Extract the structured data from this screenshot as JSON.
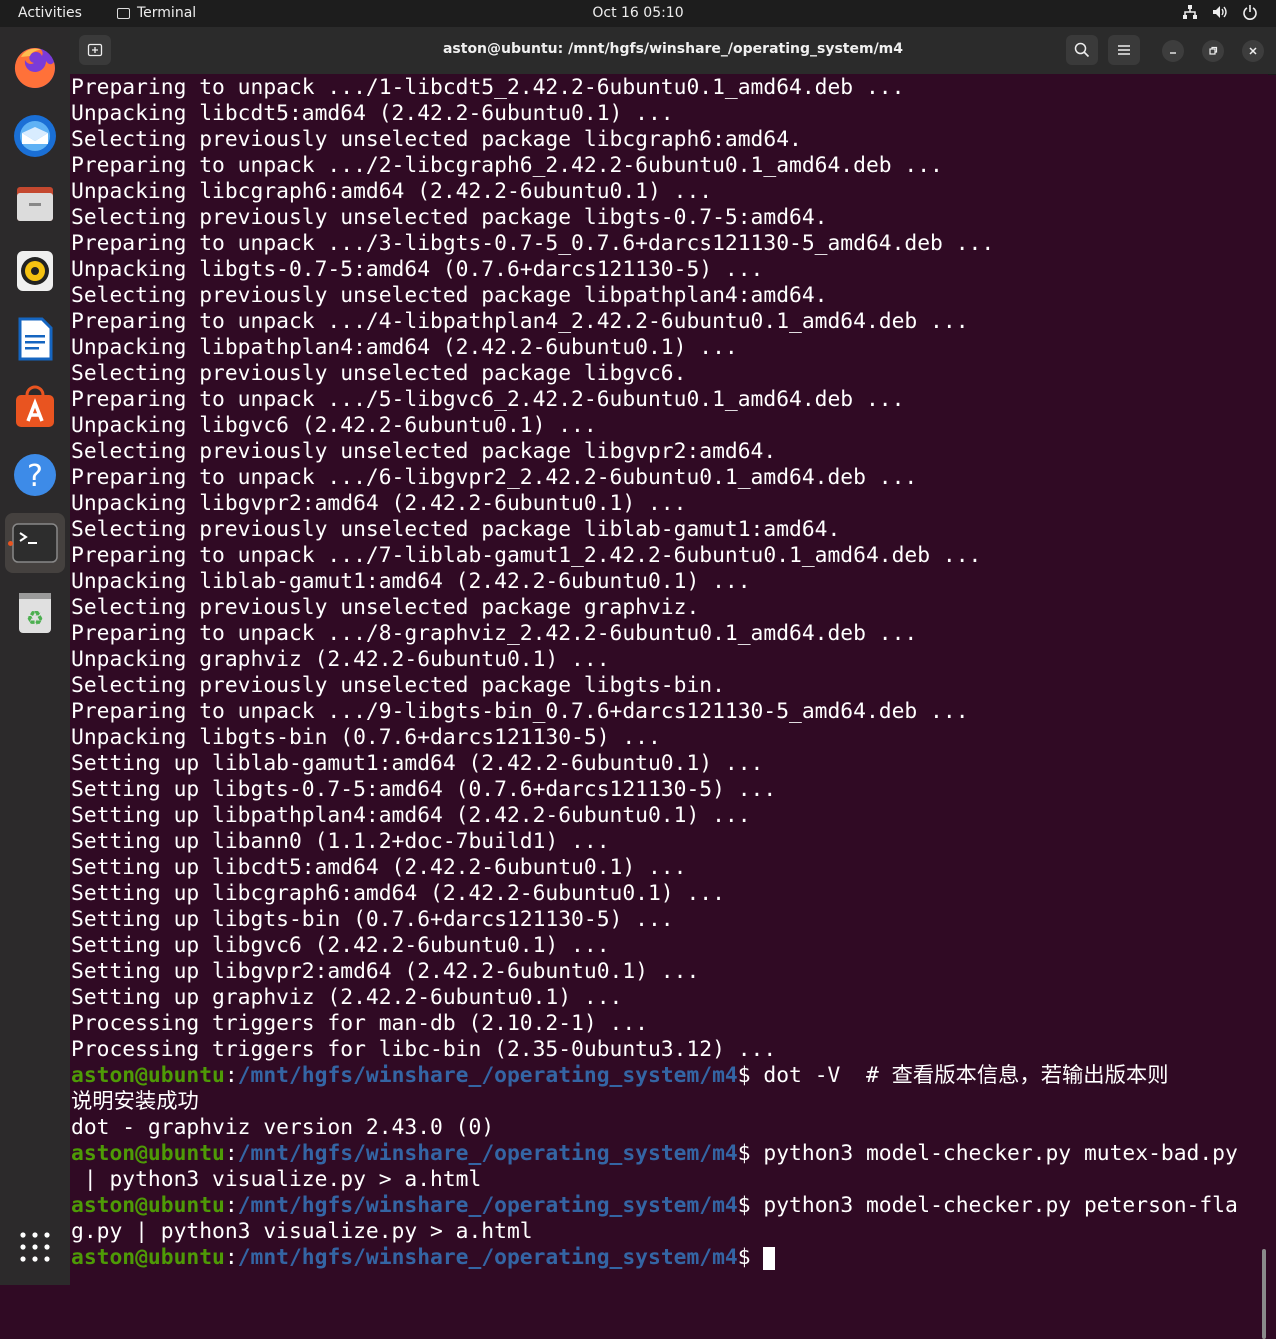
{
  "topbar": {
    "activities": "Activities",
    "app_name": "Terminal",
    "clock": "Oct 16  05:10"
  },
  "dock": {
    "items": [
      "firefox-icon",
      "thunderbird-icon",
      "files-icon",
      "rhythmbox-icon",
      "libreoffice-writer-icon",
      "app-center-icon",
      "help-icon",
      "terminal-icon",
      "trash-icon",
      "show-apps-icon"
    ]
  },
  "window": {
    "title": "aston@ubuntu: /mnt/hgfs/winshare_/operating_system/m4"
  },
  "prompt": {
    "user_host": "aston@ubuntu",
    "path": "/mnt/hgfs/winshare_/operating_system/m4"
  },
  "terminal": {
    "output": [
      "Preparing to unpack .../1-libcdt5_2.42.2-6ubuntu0.1_amd64.deb ...",
      "Unpacking libcdt5:amd64 (2.42.2-6ubuntu0.1) ...",
      "Selecting previously unselected package libcgraph6:amd64.",
      "Preparing to unpack .../2-libcgraph6_2.42.2-6ubuntu0.1_amd64.deb ...",
      "Unpacking libcgraph6:amd64 (2.42.2-6ubuntu0.1) ...",
      "Selecting previously unselected package libgts-0.7-5:amd64.",
      "Preparing to unpack .../3-libgts-0.7-5_0.7.6+darcs121130-5_amd64.deb ...",
      "Unpacking libgts-0.7-5:amd64 (0.7.6+darcs121130-5) ...",
      "Selecting previously unselected package libpathplan4:amd64.",
      "Preparing to unpack .../4-libpathplan4_2.42.2-6ubuntu0.1_amd64.deb ...",
      "Unpacking libpathplan4:amd64 (2.42.2-6ubuntu0.1) ...",
      "Selecting previously unselected package libgvc6.",
      "Preparing to unpack .../5-libgvc6_2.42.2-6ubuntu0.1_amd64.deb ...",
      "Unpacking libgvc6 (2.42.2-6ubuntu0.1) ...",
      "Selecting previously unselected package libgvpr2:amd64.",
      "Preparing to unpack .../6-libgvpr2_2.42.2-6ubuntu0.1_amd64.deb ...",
      "Unpacking libgvpr2:amd64 (2.42.2-6ubuntu0.1) ...",
      "Selecting previously unselected package liblab-gamut1:amd64.",
      "Preparing to unpack .../7-liblab-gamut1_2.42.2-6ubuntu0.1_amd64.deb ...",
      "Unpacking liblab-gamut1:amd64 (2.42.2-6ubuntu0.1) ...",
      "Selecting previously unselected package graphviz.",
      "Preparing to unpack .../8-graphviz_2.42.2-6ubuntu0.1_amd64.deb ...",
      "Unpacking graphviz (2.42.2-6ubuntu0.1) ...",
      "Selecting previously unselected package libgts-bin.",
      "Preparing to unpack .../9-libgts-bin_0.7.6+darcs121130-5_amd64.deb ...",
      "Unpacking libgts-bin (0.7.6+darcs121130-5) ...",
      "Setting up liblab-gamut1:amd64 (2.42.2-6ubuntu0.1) ...",
      "Setting up libgts-0.7-5:amd64 (0.7.6+darcs121130-5) ...",
      "Setting up libpathplan4:amd64 (2.42.2-6ubuntu0.1) ...",
      "Setting up libann0 (1.1.2+doc-7build1) ...",
      "Setting up libcdt5:amd64 (2.42.2-6ubuntu0.1) ...",
      "Setting up libcgraph6:amd64 (2.42.2-6ubuntu0.1) ...",
      "Setting up libgts-bin (0.7.6+darcs121130-5) ...",
      "Setting up libgvc6 (2.42.2-6ubuntu0.1) ...",
      "Setting up libgvpr2:amd64 (2.42.2-6ubuntu0.1) ...",
      "Setting up graphviz (2.42.2-6ubuntu0.1) ...",
      "Processing triggers for man-db (2.10.2-1) ...",
      "Processing triggers for libc-bin (2.35-0ubuntu3.12) ..."
    ],
    "cmd1": "$ dot -V  # 查看版本信息，若输出版本则",
    "cmd1_wrap": "说明安装成功",
    "cmd1_out": "dot - graphviz version 2.43.0 (0)",
    "cmd2": "$ python3 model-checker.py mutex-bad.py",
    "cmd2_wrap": " | python3 visualize.py > a.html",
    "cmd3": "$ python3 model-checker.py peterson-fla",
    "cmd3_wrap": "g.py | python3 visualize.py > a.html",
    "cmd4": "$ "
  },
  "colors": {
    "background": "#300a24",
    "prompt_user": "#4e9a06",
    "prompt_path": "#3465a4"
  }
}
